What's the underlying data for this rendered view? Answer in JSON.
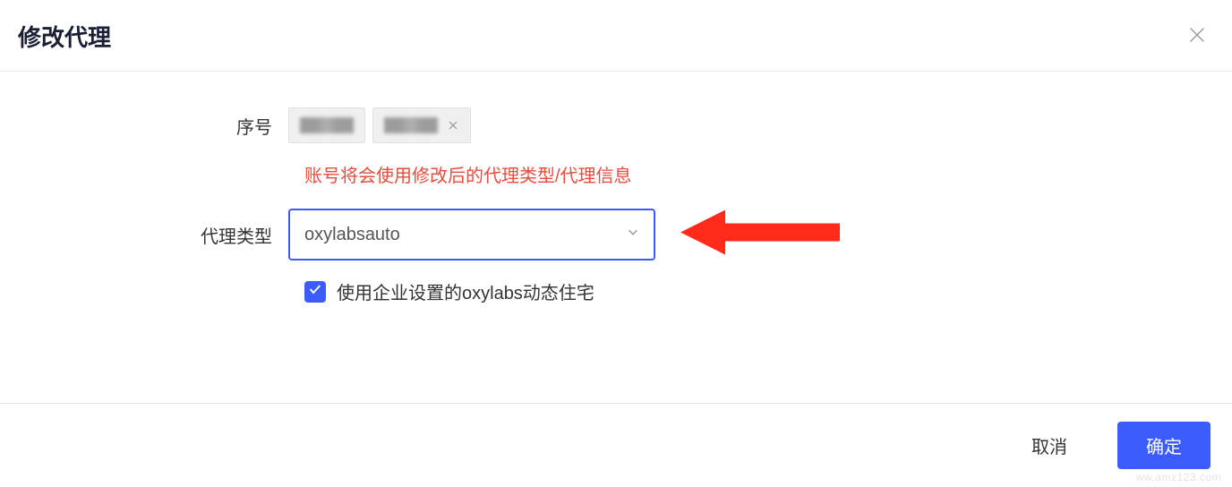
{
  "header": {
    "title": "修改代理"
  },
  "form": {
    "serial_label": "序号",
    "warning_text": "账号将会使用修改后的代理类型/代理信息",
    "proxy_type_label": "代理类型",
    "proxy_type_value": "oxylabsauto",
    "checkbox_label": "使用企业设置的oxylabs动态住宅",
    "checkbox_checked": true
  },
  "footer": {
    "cancel_label": "取消",
    "confirm_label": "确定"
  },
  "watermark": "ww.amz123.com"
}
